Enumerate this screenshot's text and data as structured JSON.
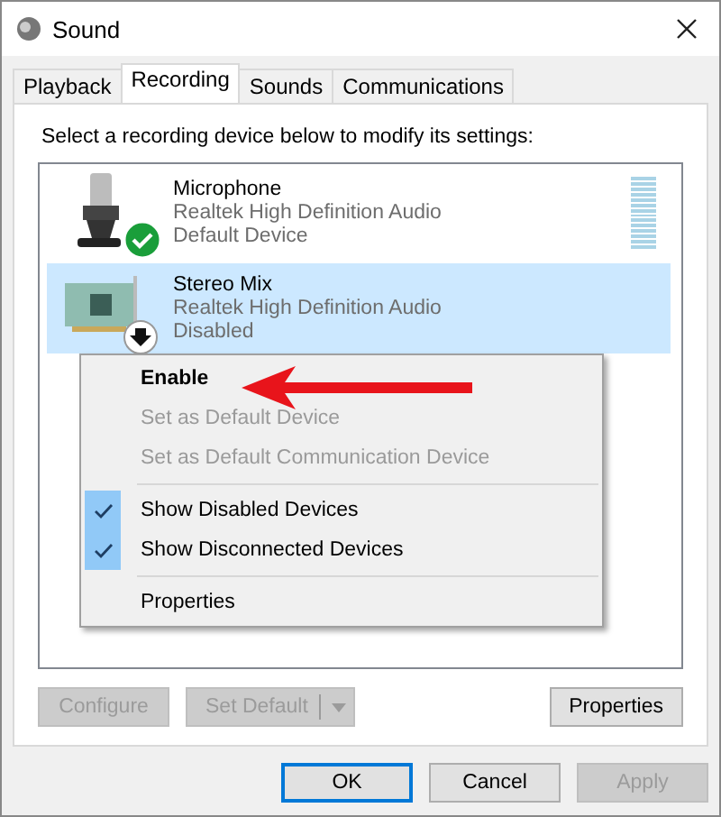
{
  "window": {
    "title": "Sound"
  },
  "tabs": [
    {
      "label": "Playback",
      "selected": false
    },
    {
      "label": "Recording",
      "selected": true
    },
    {
      "label": "Sounds",
      "selected": false
    },
    {
      "label": "Communications",
      "selected": false
    }
  ],
  "instruction": "Select a recording device below to modify its settings:",
  "devices": [
    {
      "name": "Microphone",
      "driver": "Realtek High Definition Audio",
      "state": "Default Device",
      "kind": "microphone",
      "default": true,
      "disabled": false,
      "selected": false,
      "meter": true
    },
    {
      "name": "Stereo Mix",
      "driver": "Realtek High Definition Audio",
      "state": "Disabled",
      "kind": "sound-card",
      "default": false,
      "disabled": true,
      "selected": true,
      "meter": false
    }
  ],
  "context_menu": {
    "items": [
      {
        "kind": "item",
        "label": "Enable",
        "bold": true,
        "disabled": false
      },
      {
        "kind": "item",
        "label": "Set as Default Device",
        "bold": false,
        "disabled": true
      },
      {
        "kind": "item",
        "label": "Set as Default Communication Device",
        "bold": false,
        "disabled": true
      },
      {
        "kind": "separator"
      },
      {
        "kind": "item",
        "label": "Show Disabled Devices",
        "checked": true,
        "bold": false,
        "disabled": false
      },
      {
        "kind": "item",
        "label": "Show Disconnected Devices",
        "checked": true,
        "bold": false,
        "disabled": false
      },
      {
        "kind": "separator"
      },
      {
        "kind": "item",
        "label": "Properties",
        "bold": false,
        "disabled": false
      }
    ]
  },
  "panel_buttons": [
    {
      "label": "Configure",
      "disabled": true,
      "kind": "plain"
    },
    {
      "label": "Set Default",
      "disabled": true,
      "kind": "split"
    },
    {
      "label": "Properties",
      "disabled": false,
      "kind": "plain"
    }
  ],
  "dialog_buttons": [
    {
      "label": "OK",
      "disabled": false,
      "focused": true
    },
    {
      "label": "Cancel",
      "disabled": false,
      "focused": false
    },
    {
      "label": "Apply",
      "disabled": true,
      "focused": false
    }
  ]
}
